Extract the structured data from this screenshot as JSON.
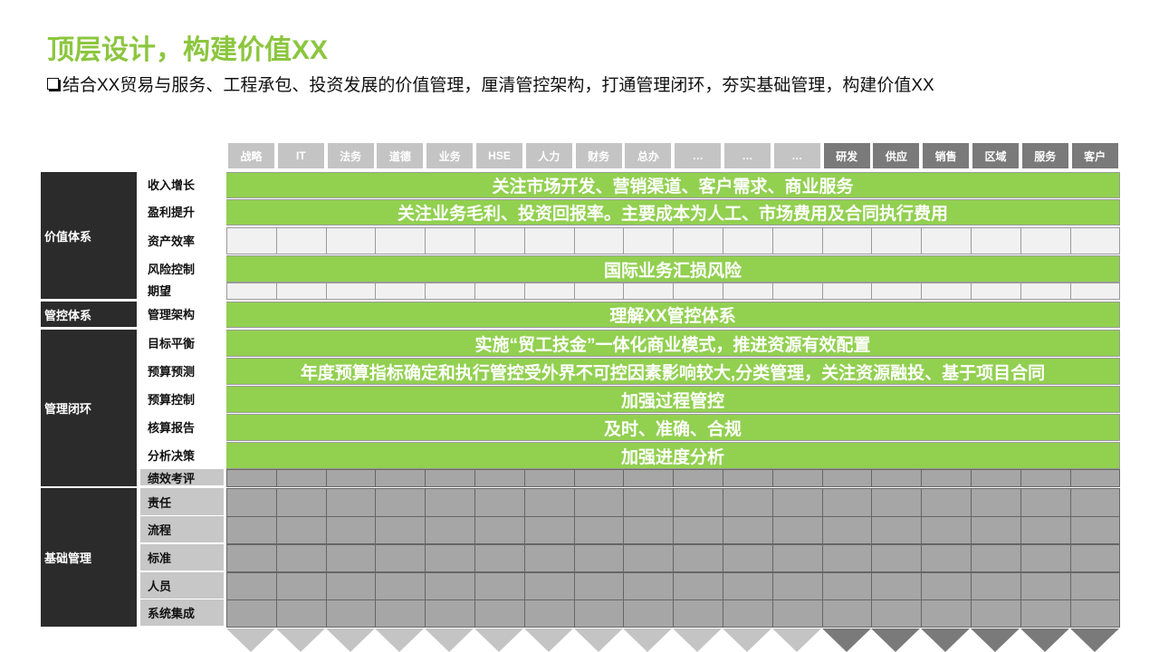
{
  "title": "顶层设计，构建价值XX",
  "subtitle": "结合XX贸易与服务、工程承包、投资发展的价值管理，厘清管控架构，打通管理闭环，夯实基础管理，构建价值XX",
  "columns": [
    "战略",
    "IT",
    "法务",
    "道德",
    "业务",
    "HSE",
    "人力",
    "财务",
    "总办",
    "…",
    "…",
    "…",
    "研发",
    "供应",
    "销售",
    "区域",
    "服务",
    "客户"
  ],
  "groups": [
    {
      "label": "价值体系"
    },
    {
      "label": "管控体系"
    },
    {
      "label": "管理闭环"
    },
    {
      "label": "基础管理"
    }
  ],
  "rows": [
    {
      "label": "收入增长"
    },
    {
      "label": "盈利提升"
    },
    {
      "label": "资产效率"
    },
    {
      "label": "风险控制"
    },
    {
      "label": "期望"
    },
    {
      "label": "管理架构"
    },
    {
      "label": "目标平衡"
    },
    {
      "label": "预算预测"
    },
    {
      "label": "预算控制"
    },
    {
      "label": "核算报告"
    },
    {
      "label": "分析决策"
    },
    {
      "label": "绩效考评"
    },
    {
      "label": "责任"
    },
    {
      "label": "流程"
    },
    {
      "label": "标准"
    },
    {
      "label": "人员"
    },
    {
      "label": "系统集成"
    }
  ],
  "bars": [
    {
      "text": "关注市场开发、营销渠道、客户需求、商业服务"
    },
    {
      "text": "关注业务毛利、投资回报率。主要成本为人工、市场费用及合同执行费用"
    },
    {
      "text": "国际业务汇损风险"
    },
    {
      "text": "理解XX管控体系"
    },
    {
      "text": "实施“贸工技金”一体化商业模式，推进资源有效配置"
    },
    {
      "text": "年度预算指标确定和执行管控受外界不可控因素影响较大,分类管理，关注资源融投、基于项目合同"
    },
    {
      "text": "加强过程管控"
    },
    {
      "text": "及时、准确、合规"
    },
    {
      "text": "加强进度分析"
    }
  ],
  "colors": {
    "accent_green": "#8cc63f",
    "bar_green": "#92d050",
    "group_bg": "#2b2b2b",
    "header_light": "#c4c4c4",
    "header_dark": "#7a7a7a"
  }
}
